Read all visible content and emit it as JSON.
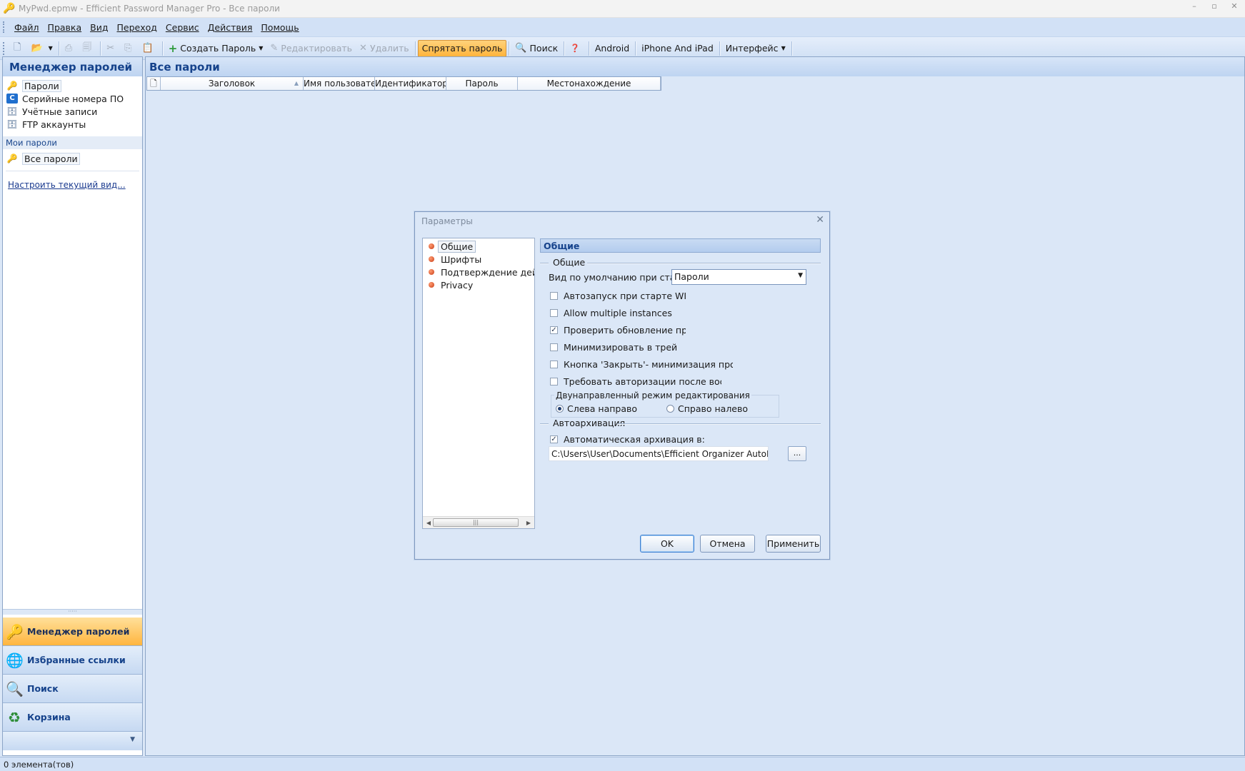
{
  "window": {
    "title": "MyPwd.epmw - Efficient Password Manager Pro - Все пароли",
    "icon": "key-icon",
    "controls": [
      "–",
      "▫",
      "✕"
    ]
  },
  "menu": [
    "Файл",
    "Правка",
    "Вид",
    "Переход",
    "Сервис",
    "Действия",
    "Помощь"
  ],
  "toolbar": {
    "create": "Создать Пароль",
    "edit": "Редактировать",
    "delete": "Удалить",
    "hide": "Спрятать пароль",
    "search": "Поиск",
    "android": "Android",
    "iphone": "iPhone And iPad",
    "interface": "Интерфейс"
  },
  "nav": {
    "header": "Менеджер паролей",
    "items": [
      "Пароли",
      "Серийные номера ПО",
      "Учётные записи",
      "FTP аккаунты"
    ],
    "group": "Мои пароли",
    "group_items": [
      "Все пароли"
    ],
    "customize_link": "Настроить текущий вид...",
    "buttons": [
      "Менеджер паролей",
      "Избранные ссылки",
      "Поиск",
      "Корзина"
    ]
  },
  "main": {
    "header": "Все пароли",
    "columns": [
      "Заголовок",
      "Имя пользовател",
      "Идентификатор а",
      "Пароль",
      "Местонахождение"
    ]
  },
  "status": "0 элемента(тов)",
  "dialog": {
    "title": "Параметры",
    "tree": [
      "Общие",
      "Шрифты",
      "Подтверждение действи",
      "Privacy"
    ],
    "section_title": "Общие",
    "group_general": "Общие",
    "default_view_label": "Вид по умолчанию при старте",
    "default_view_value": "Пароли",
    "checkboxes": [
      {
        "label": "Автозапуск при старте WIndow",
        "checked": false
      },
      {
        "label": "Allow multiple instances",
        "checked": false
      },
      {
        "label": "Проверить обновление при за",
        "checked": true
      },
      {
        "label": "Минимизировать в трей",
        "checked": false
      },
      {
        "label": "Кнопка 'Закрыть'- минимизация программ",
        "checked": false
      },
      {
        "label": "Требовать авторизации после восстанов",
        "checked": false
      }
    ],
    "bidi_legend": "Двунаправленный режим редактирования",
    "bidi_ltr": "Слева направо",
    "bidi_rtl": "Справо налево",
    "group_backup": "Автоархивация",
    "autobackup_label": "Автоматическая архивация в:",
    "autobackup_checked": true,
    "backup_path": "C:\\Users\\User\\Documents\\Efficient Organizer AutoBackup\\",
    "browse": "...",
    "ok": "OK",
    "cancel": "Отмена",
    "apply": "Применить"
  }
}
